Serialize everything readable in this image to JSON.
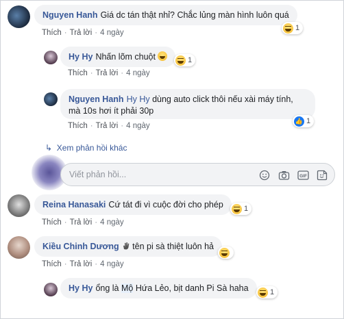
{
  "comments": [
    {
      "author": "Nguyen Hanh",
      "text": "Giá dc tán thật nhỉ? Chắc lủng màn hình luôn quá",
      "like_label": "Thích",
      "reply_label": "Trả lời",
      "time": "4 ngày",
      "reaction_count": "1",
      "reaction": "haha"
    },
    {
      "author": "Hy Hy",
      "text": "Nhấn lõm chuột",
      "like_label": "Thích",
      "reply_label": "Trả lời",
      "time": "4 ngày",
      "reaction_count": "1",
      "reaction": "haha"
    },
    {
      "author": "Nguyen Hanh",
      "mention": "Hy Hy",
      "text_line1": "dùng auto click thôi nếu xài máy tính,",
      "text_line2": "mà 10s hơi ít phải 30p",
      "like_label": "Thích",
      "reply_label": "Trả lời",
      "time": "4 ngày",
      "reaction_count": "1",
      "reaction": "like"
    },
    {
      "author": "Reina Hanasaki",
      "text": "Cứ tát đi vì cuộc đời cho phép",
      "like_label": "Thích",
      "reply_label": "Trả lời",
      "time": "4 ngày",
      "reaction_count": "1",
      "reaction": "haha"
    },
    {
      "author": "Kiều Chinh Dương",
      "text": "tên pi sà thiệt luôn hả",
      "like_label": "Thích",
      "reply_label": "Trả lời",
      "time": "4 ngày",
      "reaction_count": "",
      "reaction": "haha"
    },
    {
      "author": "Hy Hy",
      "text_before": "ổng là ",
      "text_highlight": "Mộ",
      "text_after": " Hứa Lẻo, bịt danh Pi Sà haha",
      "reaction_count": "1",
      "reaction": "haha"
    }
  ],
  "more_replies": "Xem phản hồi khác",
  "reply_box": {
    "placeholder": "Viết phản hồi...",
    "tools": [
      "emoji-icon",
      "camera-icon",
      "gif-icon",
      "sticker-icon"
    ]
  },
  "colors": {
    "name": "#385898",
    "bubble": "#f2f3f5",
    "meta": "#606770",
    "like_blue": "#1877f2"
  }
}
